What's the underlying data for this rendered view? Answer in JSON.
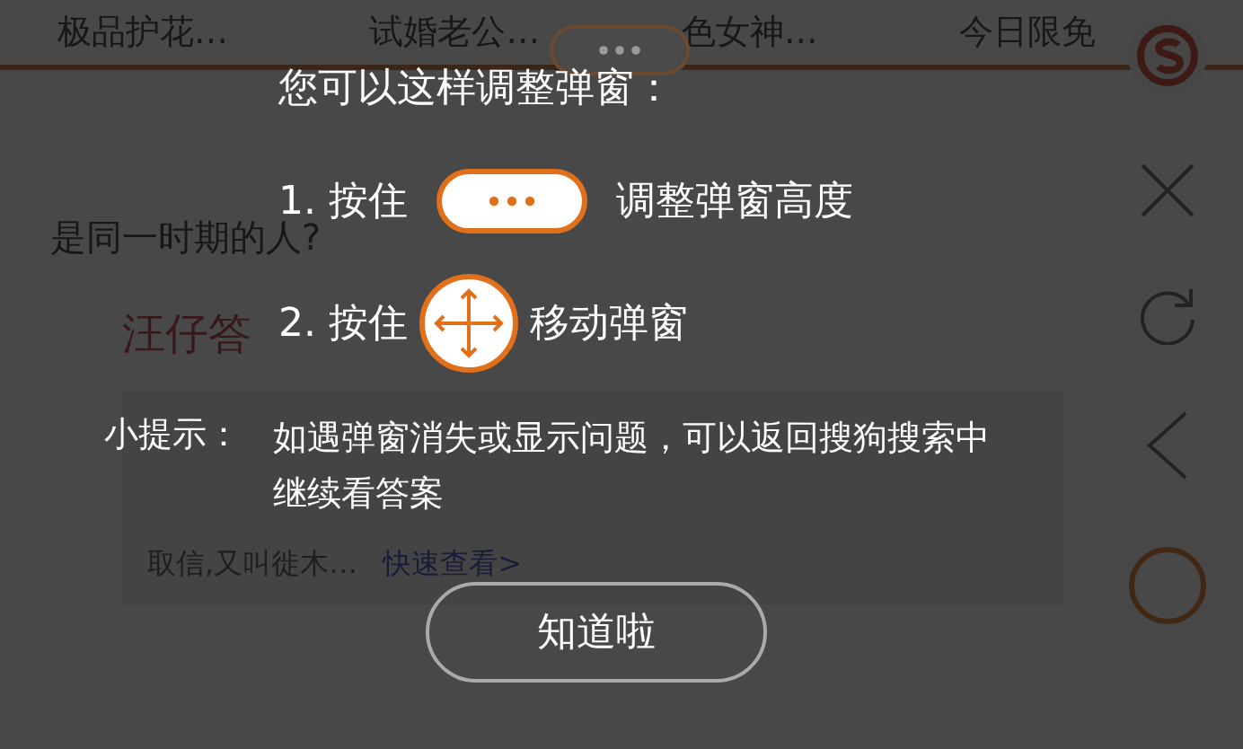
{
  "tabs": [
    {
      "label": "极品护花…",
      "selected": false
    },
    {
      "label": "试婚老公…",
      "selected": false
    },
    {
      "label": "色女神…",
      "selected": false
    },
    {
      "label": "今日限免",
      "selected": false
    }
  ],
  "question": {
    "text": "是同一时期的人?",
    "answer_heading": "汪仔答",
    "answer_tail": "取信,又叫徙木…",
    "more_link": "快速查看>"
  },
  "guide": {
    "title": "您可以这样调整弹窗：",
    "steps": [
      {
        "kind": "resize",
        "prefix": "1. 按住",
        "action": "调整弹窗高度"
      },
      {
        "kind": "move",
        "prefix": "2. 按住",
        "action": "移动弹窗"
      }
    ],
    "tip_label": "小提示：",
    "tip_lines": [
      "如遇弹窗消失或显示问题，可以返回搜狗搜索中",
      "继续看答案"
    ],
    "button": "知道啦"
  }
}
